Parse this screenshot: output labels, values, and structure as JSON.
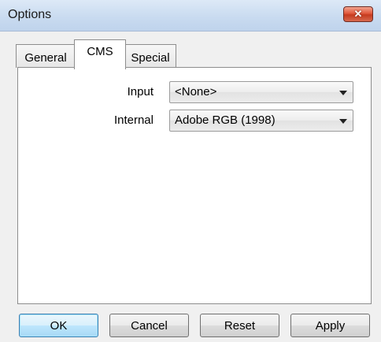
{
  "window": {
    "title": "Options",
    "close_label": "✕"
  },
  "tabs": [
    {
      "label": "General",
      "active": false
    },
    {
      "label": "CMS",
      "active": true
    },
    {
      "label": "Special",
      "active": false
    }
  ],
  "cms": {
    "input": {
      "label": "Input",
      "value": "<None>"
    },
    "internal": {
      "label": "Internal",
      "value": "Adobe RGB (1998)"
    }
  },
  "buttons": {
    "ok": "OK",
    "cancel": "Cancel",
    "reset": "Reset",
    "apply": "Apply"
  },
  "colors": {
    "titlebar": "#c9dbf0",
    "close_button": "#d8553a",
    "default_button": "#bee6fd"
  }
}
